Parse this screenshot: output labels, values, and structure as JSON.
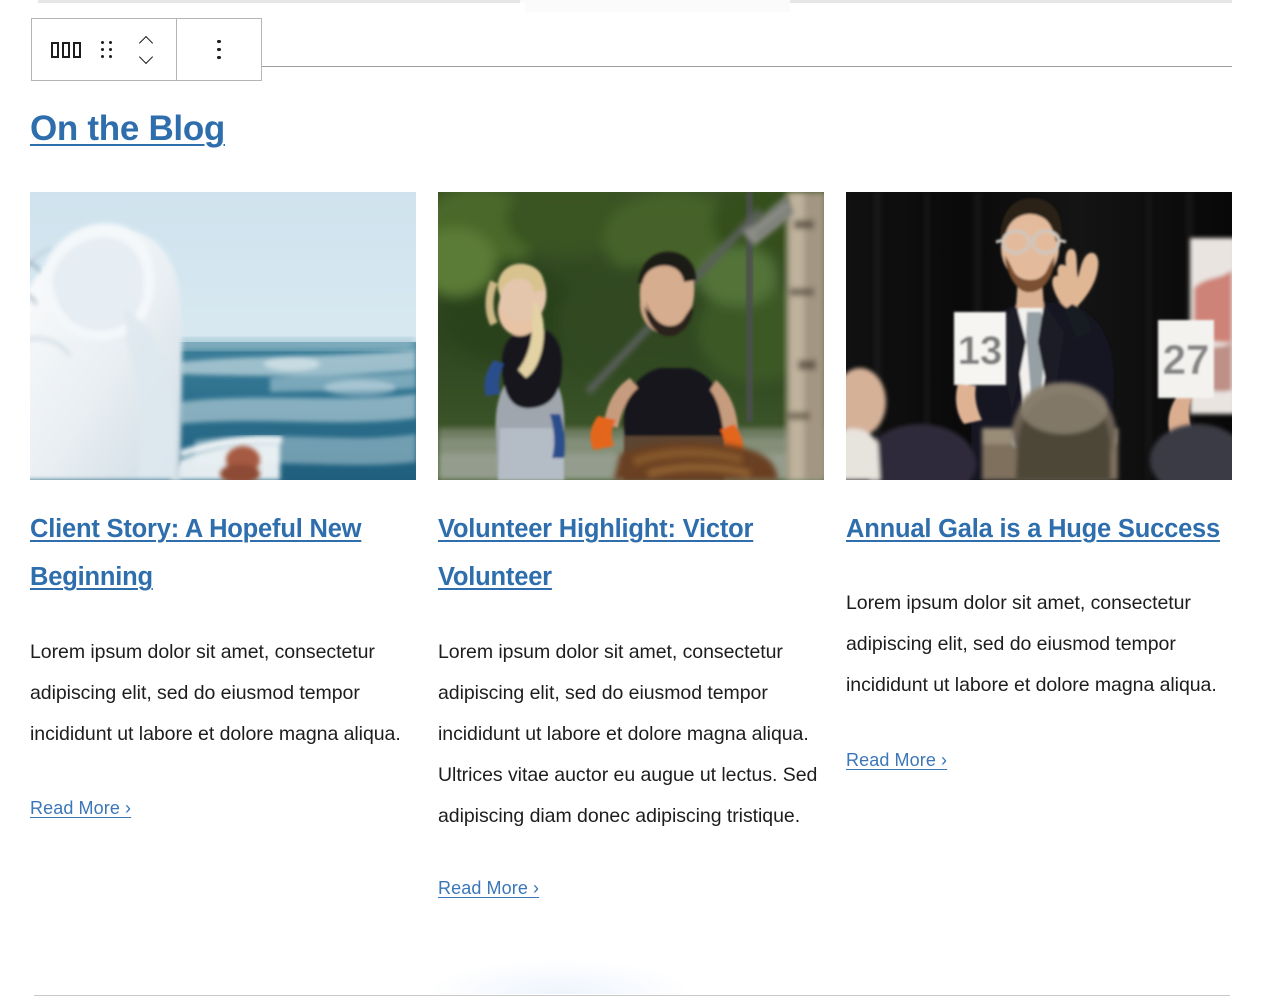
{
  "editor_toolbar": {
    "block_type_icon": "columns-icon",
    "drag_handle_icon": "drag-handle-icon",
    "move_up_icon": "chevron-up-icon",
    "move_down_icon": "chevron-down-icon",
    "more_options_icon": "ellipsis-vertical-icon",
    "aria_labels": {
      "block_type": "Columns",
      "drag": "Drag",
      "move_up": "Move up",
      "move_down": "Move down",
      "options": "Options"
    }
  },
  "section": {
    "heading": "On the Blog"
  },
  "posts": [
    {
      "title": "Client Story: A Hopeful New Beginning",
      "excerpt": "Lorem ipsum dolor sit amet, consectetur adipiscing elit, sed do eiusmod tempor incididunt ut labore et dolore magna aliqua.",
      "read_more": "Read More ›",
      "image_alt": "Person in a white hooded jacket looking out over the sea from a boat"
    },
    {
      "title": "Volunteer Highlight: Victor Volunteer",
      "excerpt": "Lorem ipsum dolor sit amet, consectetur adipiscing elit, sed do eiusmod tempor incididunt ut labore et dolore magna aliqua. Ultrices vitae auctor eu augue ut lectus. Sed adipiscing diam donec adipiscing tristique.",
      "read_more": "Read More ›",
      "image_alt": "Two volunteers with rakes and work gloves clearing leaves outdoors"
    },
    {
      "title": "Annual Gala is a Huge Success",
      "excerpt": "Lorem ipsum dolor sit amet, consectetur adipiscing elit, sed do eiusmod tempor incididunt ut labore et dolore magna aliqua.",
      "read_more": "Read More ›",
      "image_alt": "Auctioneer in a suit at a gala with bidders raising paddles numbered 13 and 27"
    }
  ],
  "colors": {
    "link_blue": "#2e6ead",
    "read_more_blue": "#3a76b8",
    "body_text": "#1d1d1d",
    "toolbar_border": "#b5b5b5",
    "divider": "#c9c9c9"
  },
  "paddle_numbers": [
    "13",
    "27"
  ]
}
